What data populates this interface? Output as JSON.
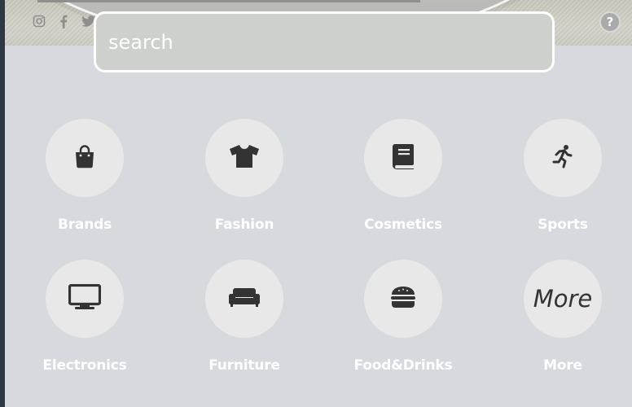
{
  "search": {
    "placeholder": "search"
  },
  "header": {
    "help_label": "?"
  },
  "social": {
    "icons": [
      "instagram-icon",
      "facebook-icon",
      "twitter-icon"
    ]
  },
  "colors": {
    "background": "#d6d9de",
    "circle": "#e8e8e8",
    "icon": "#333333",
    "label": "#ffffff"
  },
  "categories": [
    {
      "label": "Brands",
      "icon": "shopping-bag-icon"
    },
    {
      "label": "Fashion",
      "icon": "tshirt-icon"
    },
    {
      "label": "Cosmetics",
      "icon": "book-icon"
    },
    {
      "label": "Sports",
      "icon": "running-person-icon"
    },
    {
      "label": "Electronics",
      "icon": "monitor-icon"
    },
    {
      "label": "Furniture",
      "icon": "couch-icon"
    },
    {
      "label": "Food&Drinks",
      "icon": "burger-icon"
    },
    {
      "label": "More",
      "icon_text": "More"
    }
  ]
}
